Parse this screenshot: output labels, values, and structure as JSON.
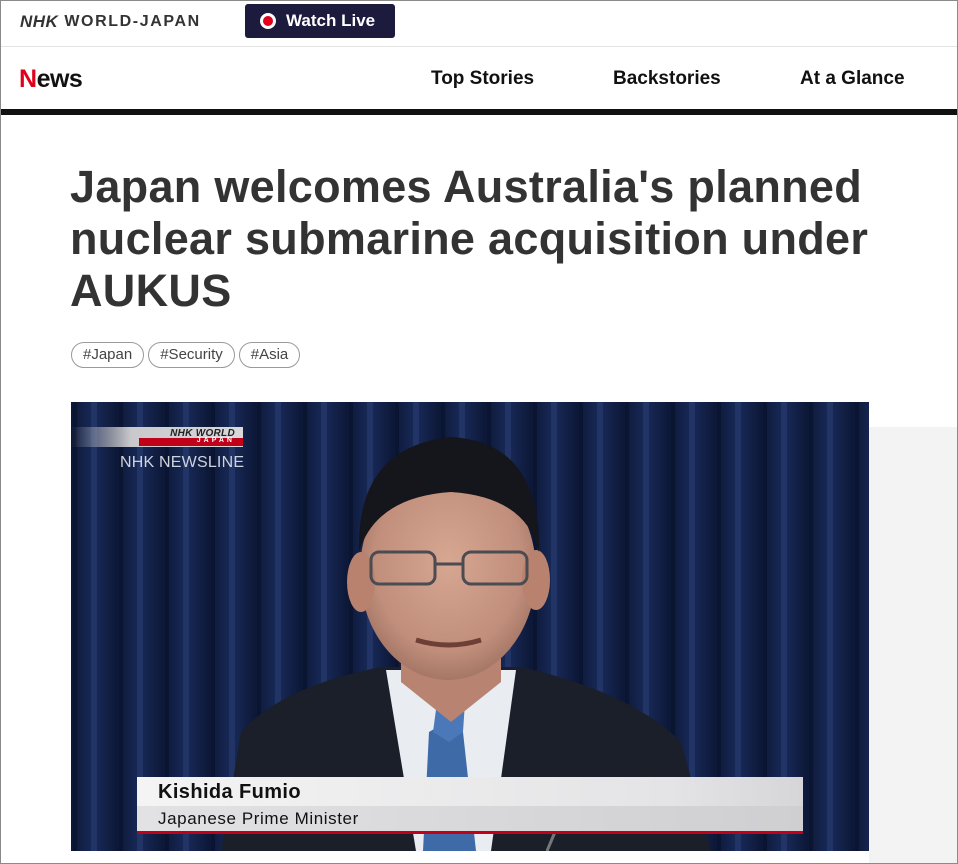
{
  "brand": {
    "logo_nhk": "NHK",
    "logo_world_japan": "WORLD-JAPAN",
    "watch_live_label": "Watch Live"
  },
  "nav": {
    "section_logo_first": "N",
    "section_logo_rest": "ews",
    "tabs": [
      {
        "label": "Top Stories",
        "active": true
      },
      {
        "label": "Backstories",
        "active": false
      },
      {
        "label": "At a Glance",
        "active": false
      }
    ]
  },
  "article": {
    "headline_lines": [
      "Japan welcomes Australia's planned",
      "nuclear submarine acquisition under",
      "AUKUS"
    ],
    "tags": [
      "#Japan",
      "#Security",
      "#Asia"
    ]
  },
  "video": {
    "bug_logo": "NHK WORLD",
    "bug_sub": "JAPAN",
    "program": "NHK NEWSLINE",
    "caption_name": "Kishida Fumio",
    "caption_title": "Japanese Prime Minister"
  },
  "colors": {
    "accent_red": "#e0001b",
    "watch_live_bg": "#1c1a3d",
    "headline_text": "#333333"
  }
}
